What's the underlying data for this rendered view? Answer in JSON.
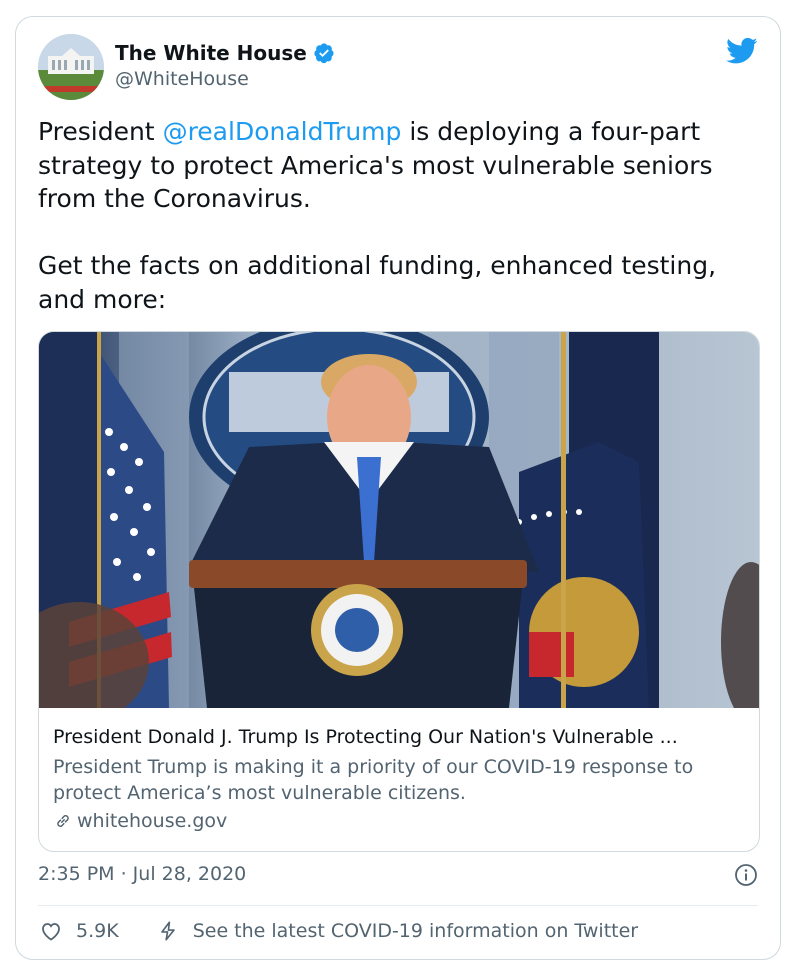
{
  "account": {
    "display_name": "The White House",
    "handle": "@WhiteHouse",
    "verified_icon": "verified-badge-icon",
    "platform_icon": "twitter-bird-icon"
  },
  "tweet": {
    "text_before_mention": "President ",
    "mention": "@realDonaldTrump",
    "text_after_mention": " is deploying a four-part strategy to protect America's most vulnerable seniors from the Coronavirus.\n\nGet the facts on additional funding, enhanced testing, and more:"
  },
  "link_card": {
    "image_icon": "press-briefing-photo",
    "title": "President Donald J. Trump Is Protecting Our Nation's Vulnerable ...",
    "description": "President Trump is making it a priority of our COVID-19 response to protect America’s most vulnerable citizens.",
    "domain": "whitehouse.gov"
  },
  "meta": {
    "timestamp": "2:35 PM · Jul 28, 2020"
  },
  "actions": {
    "like_count": "5.9K",
    "info_label": "See the latest COVID-19 information on Twitter"
  },
  "colors": {
    "link_blue": "#1d9bf0",
    "muted": "#536471",
    "border": "#cfd9de"
  }
}
